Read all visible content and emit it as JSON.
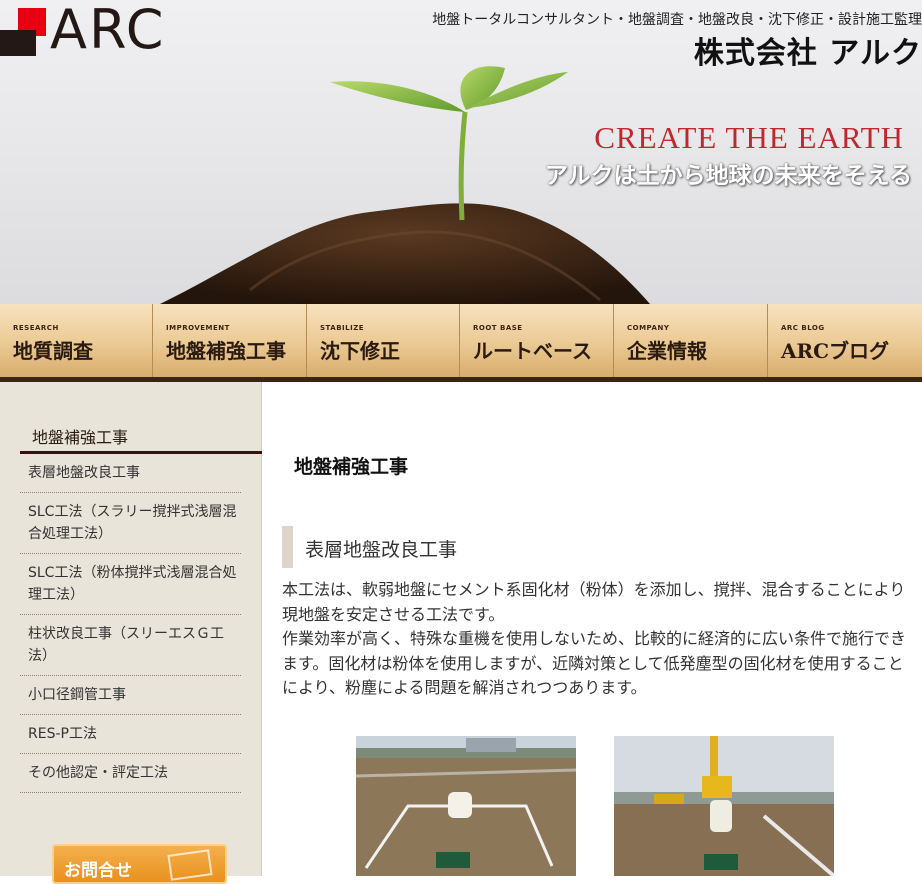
{
  "header": {
    "logo_text": "ARC",
    "tagline": "地盤トータルコンサルタント・地盤調査・地盤改良・沈下修正・設計施工監理",
    "company_name": "株式会社 アルク",
    "hero_title": "CREATE THE EARTH",
    "hero_subtitle": "アルクは土から地球の未来をそえる"
  },
  "nav": [
    {
      "en": "RESEARCH",
      "jp": "地質調査"
    },
    {
      "en": "IMPROVEMENT",
      "jp": "地盤補強工事"
    },
    {
      "en": "STABILIZE",
      "jp": "沈下修正"
    },
    {
      "en": "ROOT BASE",
      "jp": "ルートベース"
    },
    {
      "en": "COMPANY",
      "jp": "企業情報"
    },
    {
      "en": "ARC BLOG",
      "jp": "ARCブログ"
    }
  ],
  "sidebar": {
    "title": "地盤補強工事",
    "items": [
      "表層地盤改良工事",
      "SLC工法（スラリー撹拌式浅層混合処理工法）",
      "SLC工法（粉体撹拌式浅層混合処理工法）",
      "柱状改良工事（スリーエスＧ工法）",
      "小口径鋼管工事",
      "RES-P工法",
      "その他認定・評定工法"
    ],
    "contact_label": "お問合せ"
  },
  "main": {
    "page_title": "地盤補強工事",
    "section_title": "表層地盤改良工事",
    "paragraph1": "本工法は、軟弱地盤にセメント系固化材（粉体）を添加し、撹拌、混合することにより現地盤を安定させる工法です。",
    "paragraph2": "作業効率が高く、特殊な重機を使用しないため、比較的に経済的に広い条件で施行できます。固化材は粉体を使用しますが、近隣対策として低発塵型の固化材を使用することにより、粉塵による問題を解消されつつあります。"
  },
  "colors": {
    "accent_red": "#e60012",
    "nav_dark": "#3a2414",
    "hero_red": "#c1272d",
    "sidebar_bg": "#e9e4d9",
    "contact_orange": "#e88f1c"
  }
}
